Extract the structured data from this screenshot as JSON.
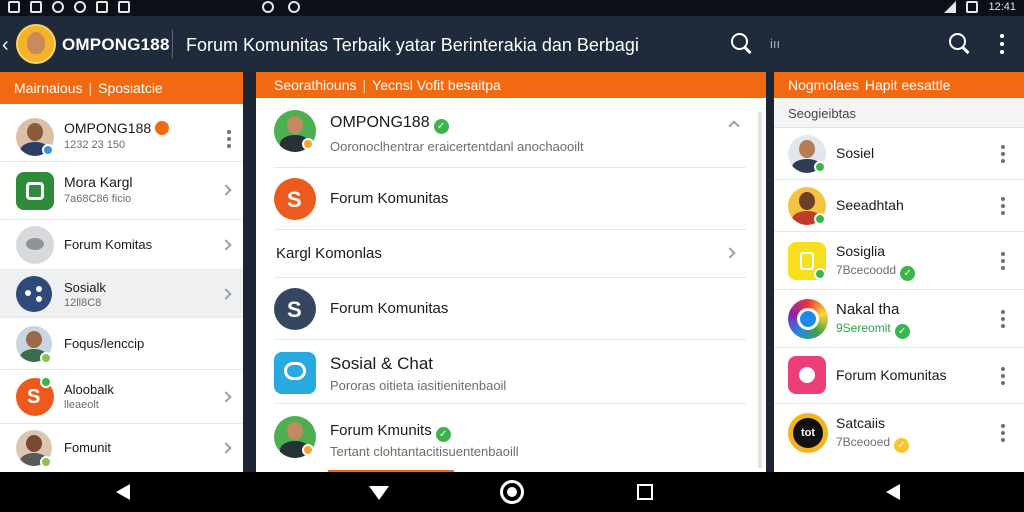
{
  "statusbar": {
    "time": "12:41"
  },
  "appbar": {
    "brand": "OMPONG188",
    "title": "Forum Komunitas Terbaik yatar Berinterakia dan Berbagi",
    "search_hint": "iıı"
  },
  "left_panel": {
    "header": [
      "Mairnaious",
      "Sposiatcie"
    ],
    "items": [
      {
        "name": "OMPONG188",
        "sub": "1232 23 150",
        "icon": "person-avatar"
      },
      {
        "name": "Mora Kargl",
        "sub": "7a68C86 ficio",
        "icon": "leaf-app-icon"
      },
      {
        "name": "Forum Komitas",
        "sub": "",
        "icon": "bird-icon"
      },
      {
        "name": "Sosialk",
        "sub": "12ll8C8",
        "icon": "dots-app-icon"
      },
      {
        "name": "Foqus/lenccip",
        "sub": "",
        "icon": "person-avatar"
      },
      {
        "name": "Aloobalk",
        "sub": "lleaeolt",
        "icon": "s-app-icon"
      },
      {
        "name": "Fomunit",
        "sub": "",
        "icon": "person-avatar"
      }
    ]
  },
  "center_panel": {
    "header": [
      "Seorathiouns",
      "Yecnsl Vofit besaitpa"
    ],
    "items": [
      {
        "name": "OMPONG188",
        "sub": "Ooronoclhentrar eraicertentdanl anochaooilt",
        "icon": "person-avatar"
      },
      {
        "name": "Forum Komunitas",
        "sub": "",
        "icon": "s-brand-icon"
      },
      {
        "name": "Kargl Komonlas",
        "sub": "",
        "icon": ""
      },
      {
        "name": "Forum Komunitas",
        "sub": "",
        "icon": "s-navy-icon"
      },
      {
        "name": "Sosial & Chat",
        "sub": "Pororas oitieta iasitienitenbaoil",
        "icon": "chat-app-icon"
      },
      {
        "name": "Forum Kmunits",
        "sub": "Tertant clohtantacitisuentenbaoill",
        "icon": "person-avatar"
      }
    ]
  },
  "right_panel": {
    "header": [
      "Nogmolaes",
      "Hapit eesattle"
    ],
    "section": "Seogieibtas",
    "items": [
      {
        "name": "Sosiel",
        "sub": "",
        "icon": "person-avatar",
        "sub_color": ""
      },
      {
        "name": "Seeadhtah",
        "sub": "",
        "icon": "person-avatar",
        "sub_color": ""
      },
      {
        "name": "Sosiglia",
        "sub": "7Bcecoodd",
        "icon": "yellow-bag-icon",
        "sub_color": "#555555"
      },
      {
        "name": "Nakal tha",
        "sub": "9Sereomit",
        "icon": "rainbow-icon",
        "sub_color": "#2f9e44"
      },
      {
        "name": "Forum Komunitas",
        "sub": "",
        "icon": "pink-flower-icon",
        "sub_color": ""
      },
      {
        "name": "Satcaiis",
        "sub": "7Bceooed",
        "icon": "tot-icon",
        "sub_color": "#555555"
      }
    ]
  },
  "colors": {
    "accent": "#f16a12",
    "appbar": "#1f2a3a",
    "verified": "#3bb54a"
  }
}
